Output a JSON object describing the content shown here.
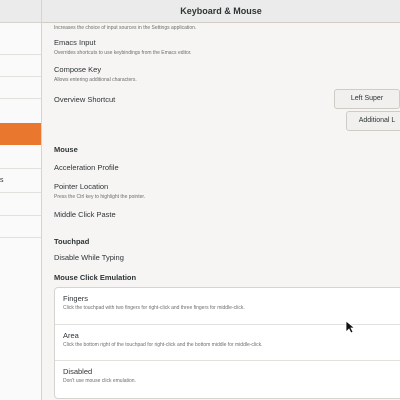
{
  "window": {
    "title": "Keyboard & Mouse"
  },
  "sidebar": {
    "fragment": "s"
  },
  "keyboard": {
    "clipped_description": "Increases the choice of input sources in the Settings application.",
    "emacs_title": "Emacs Input",
    "emacs_sub": "Overrides shortcuts to use keybindings from the Emacs editor.",
    "compose_title": "Compose Key",
    "compose_sub": "Allows entering additional characters.",
    "overview_label": "Overview Shortcut",
    "overview_value": "Left Super",
    "additional_button": "Additional L"
  },
  "mouse": {
    "section": "Mouse",
    "accel": "Acceleration Profile",
    "pointer_location": "Pointer Location",
    "pointer_location_sub": "Press the Ctrl key to highlight the pointer.",
    "middle_click": "Middle Click Paste"
  },
  "touchpad": {
    "section": "Touchpad",
    "disable_typing": "Disable While Typing"
  },
  "emulation": {
    "section": "Mouse Click Emulation",
    "options": [
      {
        "title": "Fingers",
        "sub": "Click the touchpad with two fingers for right-click and three fingers for middle-click."
      },
      {
        "title": "Area",
        "sub": "Click the bottom right of the touchpad for right-click and the bottom middle for middle-click."
      },
      {
        "title": "Disabled",
        "sub": "Don't use mouse click emulation."
      }
    ]
  }
}
